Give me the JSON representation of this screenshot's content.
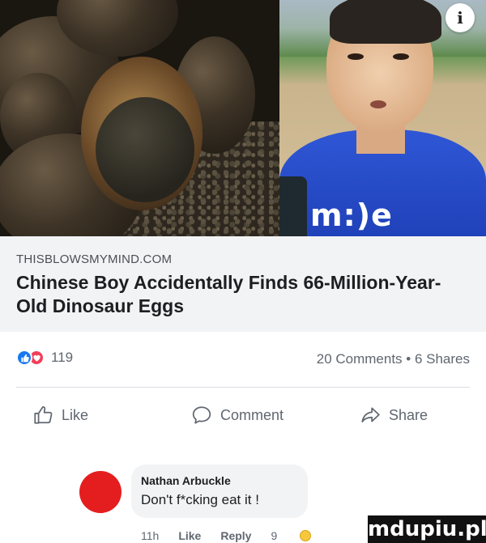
{
  "media": {
    "left_image": "dinosaur-eggs-photo",
    "right_image": "boy-interview-photo",
    "caption_mark": "m:)e",
    "info_icon": "i"
  },
  "link": {
    "domain": "THISBLOWSMYMIND.COM",
    "title": "Chinese Boy Accidentally Finds 66-Million-Year-Old Dinosaur Eggs"
  },
  "stats": {
    "reaction_icons": [
      "like-reaction-icon",
      "love-reaction-icon"
    ],
    "reaction_count": "119",
    "comments_shares": "20 Comments • 6 Shares"
  },
  "actions": {
    "like_label": "Like",
    "comment_label": "Comment",
    "share_label": "Share"
  },
  "comment": {
    "author": "Nathan Arbuckle",
    "text": "Don't f*cking eat it !",
    "time": "11h",
    "like_label": "Like",
    "reply_label": "Reply",
    "reaction_count": "9"
  },
  "watermark": {
    "text": "mdupiu.pl"
  },
  "colors": {
    "like_blue": "#1877f2",
    "love_red": "#f33e58",
    "avatar_red": "#e41e1e",
    "link_box_bg": "#f2f3f5"
  }
}
